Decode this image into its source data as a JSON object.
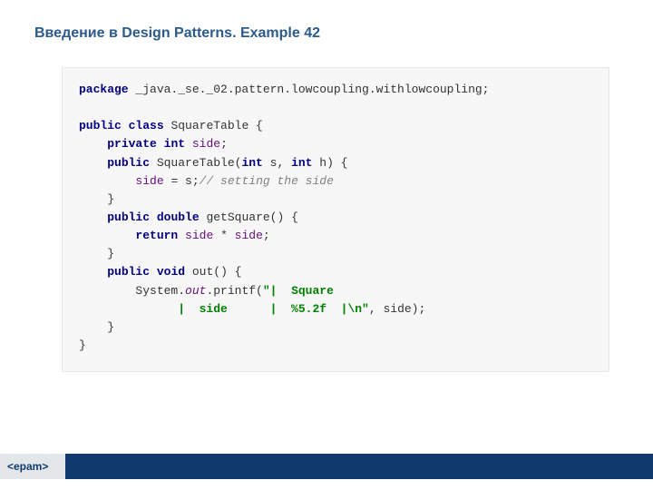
{
  "slide": {
    "title": "Введение в Design Patterns. Example 42"
  },
  "code": {
    "package_kw": "package",
    "package_name": " _java._se._02.pattern.lowcoupling.withlowcoupling;",
    "public": "public",
    "class": "class",
    "class_name": " SquareTable {",
    "private": "private",
    "int": "int",
    "field_side": "side",
    "ctor_name": " SquareTable(",
    "param_s": " s, ",
    "param_h": " h) {",
    "assign_lhs": "side",
    "assign_rest": " = s;",
    "comment_side": "// setting the side",
    "close_brace": "    }",
    "double": "double",
    "method_getSquare": " getSquare() {",
    "return": "return",
    "ret_expr_1": " ",
    "ret_side1": "side",
    "ret_mid": " * ",
    "ret_side2": "side",
    "semicolon": ";",
    "void": "void",
    "method_out": " out() {",
    "sys_prefix": "        System.",
    "out_static": "out",
    "printf_call": ".printf(",
    "str1": "\"|  Square            ",
    "str2": "              |  side      |  %5.2f  |\\n\"",
    "after_str": ", side);",
    "close_brace2": "    }",
    "close_class": "}"
  },
  "footer": {
    "logo_text": "<epam>"
  }
}
